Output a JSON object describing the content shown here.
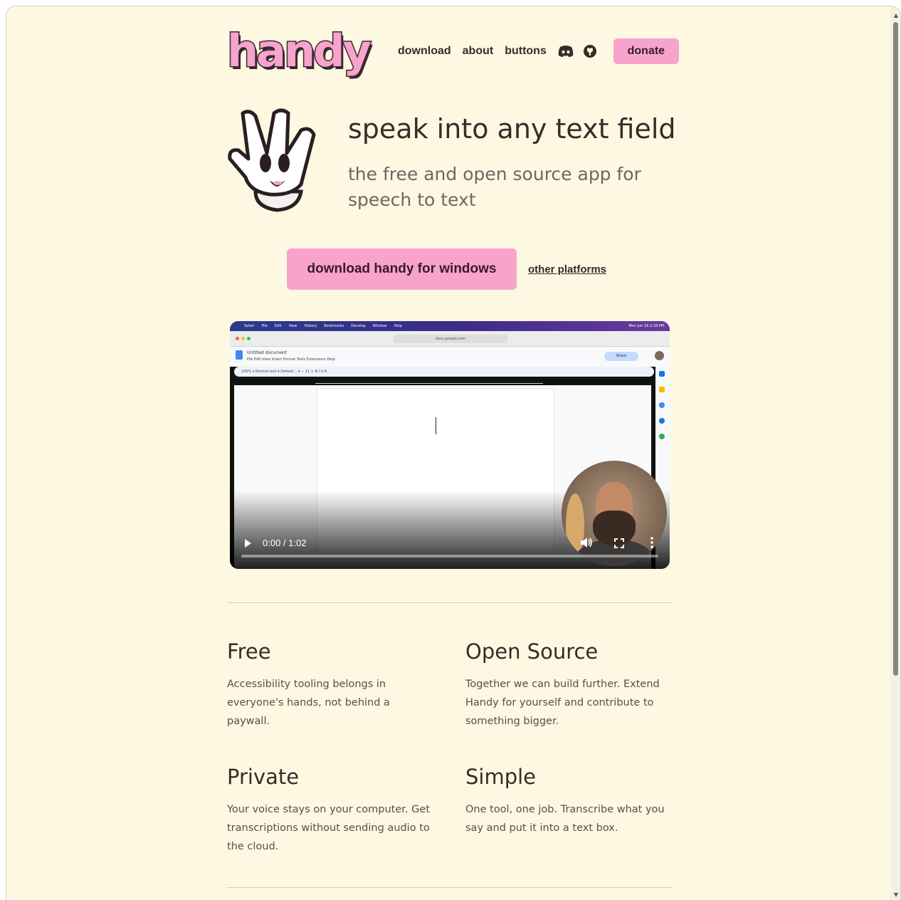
{
  "header": {
    "logo_text": "handy",
    "nav": [
      "download",
      "about",
      "buttons"
    ],
    "icons": [
      "discord-icon",
      "github-icon"
    ],
    "donate_label": "donate"
  },
  "hero": {
    "title": "speak into any text field",
    "subtitle": "the free and open source app for speech to text",
    "cta_label": "download handy for windows",
    "secondary_label": "other platforms"
  },
  "video": {
    "time": "0:00 / 1:02",
    "progress": 0.0,
    "screen": {
      "menubar_items": [
        "Safari",
        "File",
        "Edit",
        "View",
        "History",
        "Bookmarks",
        "Develop",
        "Window",
        "Help"
      ],
      "menubar_right": "Mon Jun 16  2:18 PM",
      "url": "docs.google.com",
      "doc_title": "Untitled document",
      "doc_menus": "File   Edit   View   Insert   Format   Tools   Extensions   Help",
      "toolbar": "100%  ▾   Normal text  ▾   Default...  ▾   −  11  +   B  I  U  A",
      "share_label": "Share"
    }
  },
  "features": [
    {
      "title": "Free",
      "text": "Accessibility tooling belongs in everyone's hands, not behind a paywall."
    },
    {
      "title": "Open Source",
      "text": "Together we can build further. Extend Handy for yourself and contribute to something bigger."
    },
    {
      "title": "Private",
      "text": "Your voice stays on your computer. Get transcriptions without sending audio to the cloud."
    },
    {
      "title": "Simple",
      "text": "One tool, one job. Transcribe what you say and put it into a text box."
    }
  ],
  "colors": {
    "background": "#fdf8e1",
    "accent_pink": "#f7a3cc",
    "text_dark": "#3a2a2a"
  }
}
